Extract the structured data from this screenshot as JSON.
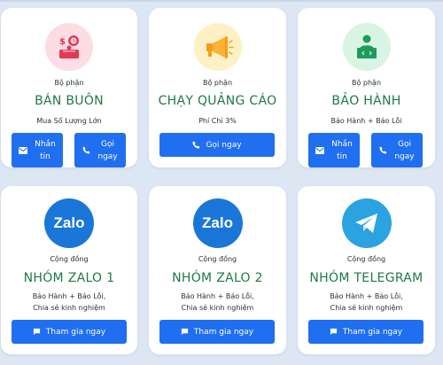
{
  "cards": [
    {
      "eyebrow": "Bộ phận",
      "title": "BÁN BUÔN",
      "desc": "Mua Số Lượng Lớn",
      "icon": "wholesale-icon",
      "buttons": [
        {
          "label": "Nhắn tin",
          "icon": "mail-icon"
        },
        {
          "label": "Gọi ngay",
          "icon": "phone-icon"
        }
      ]
    },
    {
      "eyebrow": "Bộ phận",
      "title": "CHẠY QUẢNG CÁO",
      "desc": "Phí Chỉ 3%",
      "icon": "megaphone-icon",
      "buttons": [
        {
          "label": "Gọi ngay",
          "icon": "phone-icon"
        }
      ]
    },
    {
      "eyebrow": "Bộ phận",
      "title": "BẢO HÀNH",
      "desc": "Bảo Hành + Báo Lỗi",
      "icon": "support-icon",
      "buttons": [
        {
          "label": "Nhắn tin",
          "icon": "mail-icon"
        },
        {
          "label": "Gọi ngay",
          "icon": "phone-icon"
        }
      ]
    },
    {
      "eyebrow": "Cộng đồng",
      "title": "NHÓM ZALO 1",
      "desc_lines": [
        "Bảo Hành + Báo Lỗi,",
        "Chia sẻ kinh nghiệm"
      ],
      "icon": "zalo-icon",
      "icon_text": "Zalo",
      "buttons": [
        {
          "label": "Tham gia ngay",
          "icon": "chat-icon"
        }
      ]
    },
    {
      "eyebrow": "Cộng đồng",
      "title": "NHÓM ZALO 2",
      "desc_lines": [
        "Bảo Hành + Báo Lỗi,",
        "Chia sẻ kinh nghiệm"
      ],
      "icon": "zalo-icon",
      "icon_text": "Zalo",
      "buttons": [
        {
          "label": "Tham gia ngay",
          "icon": "chat-icon"
        }
      ]
    },
    {
      "eyebrow": "Cộng đồng",
      "title": "NHÓM TELEGRAM",
      "desc_lines": [
        "Bảo Hành + Báo Lỗi,",
        "Chia sẻ kinh nghiệm"
      ],
      "icon": "telegram-icon",
      "buttons": [
        {
          "label": "Tham gia ngay",
          "icon": "chat-icon"
        }
      ]
    }
  ],
  "colors": {
    "title_green": "#1d7a45",
    "button_blue": "#1f6ff0",
    "zalo_blue": "#1a76d8",
    "telegram_blue": "#2aa3e0"
  }
}
